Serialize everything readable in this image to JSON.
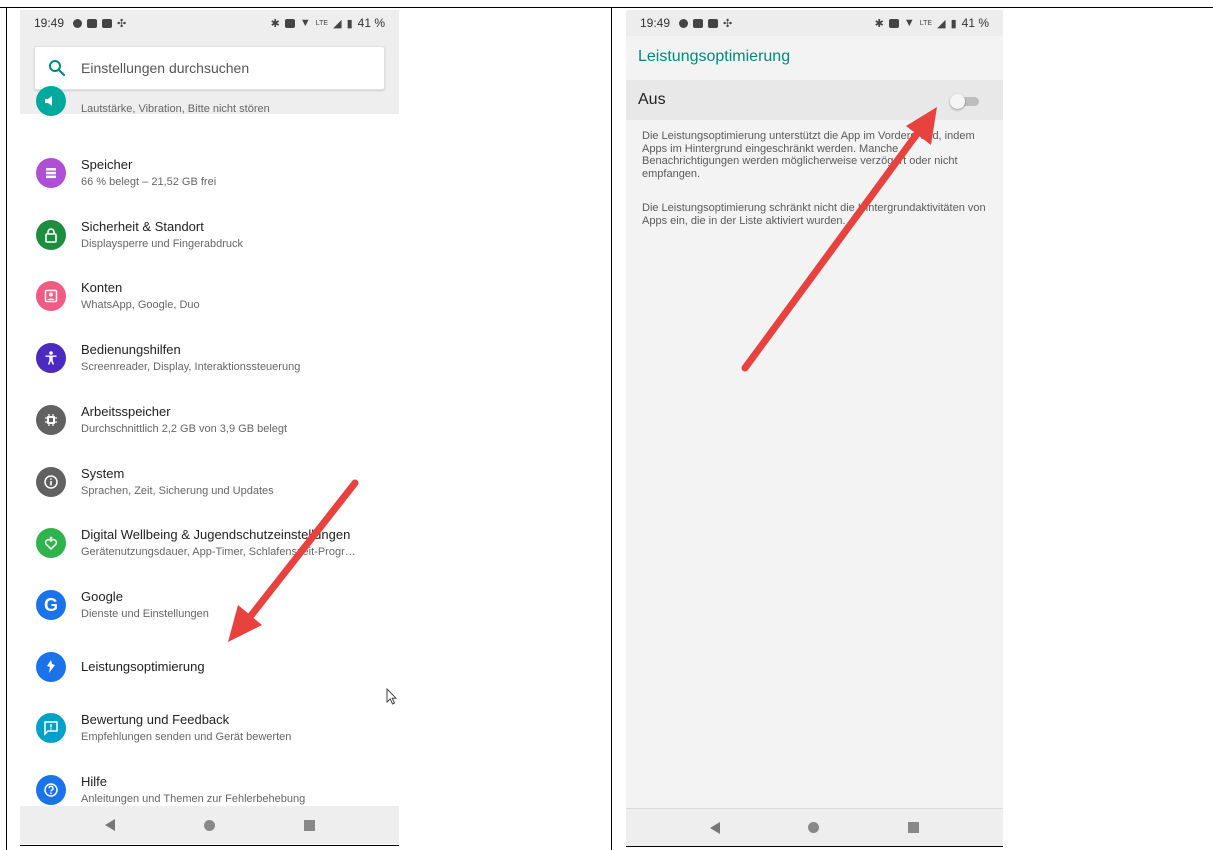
{
  "status_bar": {
    "time": "19:49",
    "battery": "41 %",
    "network": "LTE"
  },
  "settings": {
    "search_placeholder": "Einstellungen durchsuchen",
    "items": [
      {
        "title": "",
        "subtitle": "Lautstärke, Vibration, Bitte nicht stören",
        "icon": "volume-icon",
        "color": "#00a99d"
      },
      {
        "title": "Speicher",
        "subtitle": "66 % belegt – 21,52 GB frei",
        "icon": "storage-icon",
        "color": "#b04fd6"
      },
      {
        "title": "Sicherheit & Standort",
        "subtitle": "Displaysperre und Fingerabdruck",
        "icon": "lock-icon",
        "color": "#1e8e3e"
      },
      {
        "title": "Konten",
        "subtitle": "WhatsApp, Google, Duo",
        "icon": "account-icon",
        "color": "#ef5b83"
      },
      {
        "title": "Bedienungshilfen",
        "subtitle": "Screenreader, Display, Interaktionssteuerung",
        "icon": "accessibility-icon",
        "color": "#4b2bbf"
      },
      {
        "title": "Arbeitsspeicher",
        "subtitle": "Durchschnittlich 2,2 GB von 3,9 GB belegt",
        "icon": "memory-icon",
        "color": "#616161"
      },
      {
        "title": "System",
        "subtitle": "Sprachen, Zeit, Sicherung und Updates",
        "icon": "info-icon",
        "color": "#616161"
      },
      {
        "title": "Digital Wellbeing & Jugendschutzeinstellungen",
        "subtitle": "Gerätenutzungsdauer, App-Timer, Schlafenszeit-Progr…",
        "icon": "wellbeing-icon",
        "color": "#2fb34a"
      },
      {
        "title": "Google",
        "subtitle": "Dienste und Einstellungen",
        "icon": "google-icon",
        "color": "#1a73e8"
      },
      {
        "title": "Leistungsoptimierung",
        "subtitle": "",
        "icon": "optimization-icon",
        "color": "#1a73e8"
      },
      {
        "title": "Bewertung und Feedback",
        "subtitle": "Empfehlungen senden und Gerät bewerten",
        "icon": "feedback-icon",
        "color": "#00a1c9"
      },
      {
        "title": "Hilfe",
        "subtitle": "Anleitungen und Themen zur Fehlerbehebung",
        "icon": "help-icon",
        "color": "#1a73e8"
      }
    ]
  },
  "detail": {
    "title": "Leistungsoptimierung",
    "toggle_label": "Aus",
    "toggle_on": false,
    "description_1": "Die Leistungsoptimierung unterstützt die App im Vordergrund, indem Apps im Hintergrund eingeschränkt werden. Manche Benachrichtigungen werden möglicherweise verzögert oder nicht empfangen.",
    "description_2": "Die Leistungsoptimierung schränkt nicht die Hintergrundaktivitäten von Apps ein, die in der Liste aktiviert wurden."
  },
  "colors": {
    "accent": "#00897b",
    "arrow": "#e8423f"
  }
}
